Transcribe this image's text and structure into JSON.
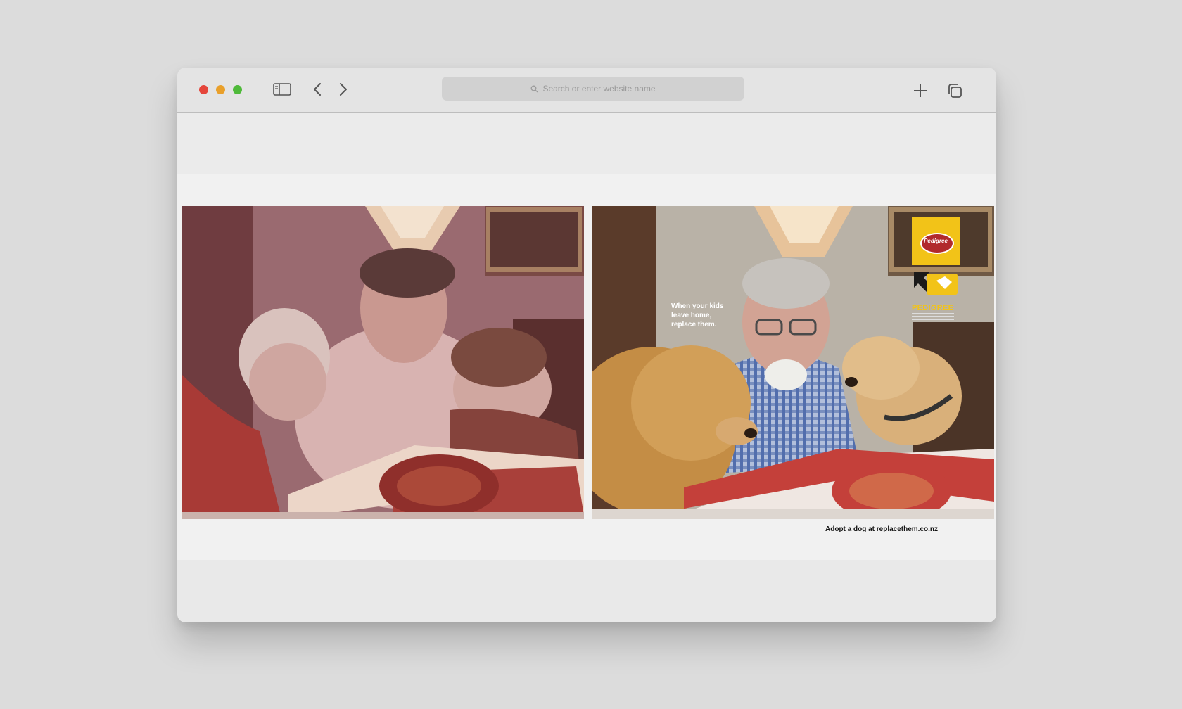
{
  "browser": {
    "search_placeholder": "Search or enter website name",
    "icons": {
      "sidebar": "sidebar-icon",
      "back": "chevron-left-icon",
      "forward": "chevron-right-icon",
      "new_tab": "plus-icon",
      "tabs": "tabs-overview-icon",
      "search": "magnifier-icon"
    }
  },
  "ad": {
    "headline": "When your kids\nleave home,\nreplace them.",
    "brand_name": "PEDIGREE",
    "brand_logo_text": "Pedigree",
    "footer_cta": "Adopt a dog at replacethem.co.nz"
  },
  "colors": {
    "brand_yellow": "#f2c318",
    "brand_red": "#b12a2c"
  }
}
